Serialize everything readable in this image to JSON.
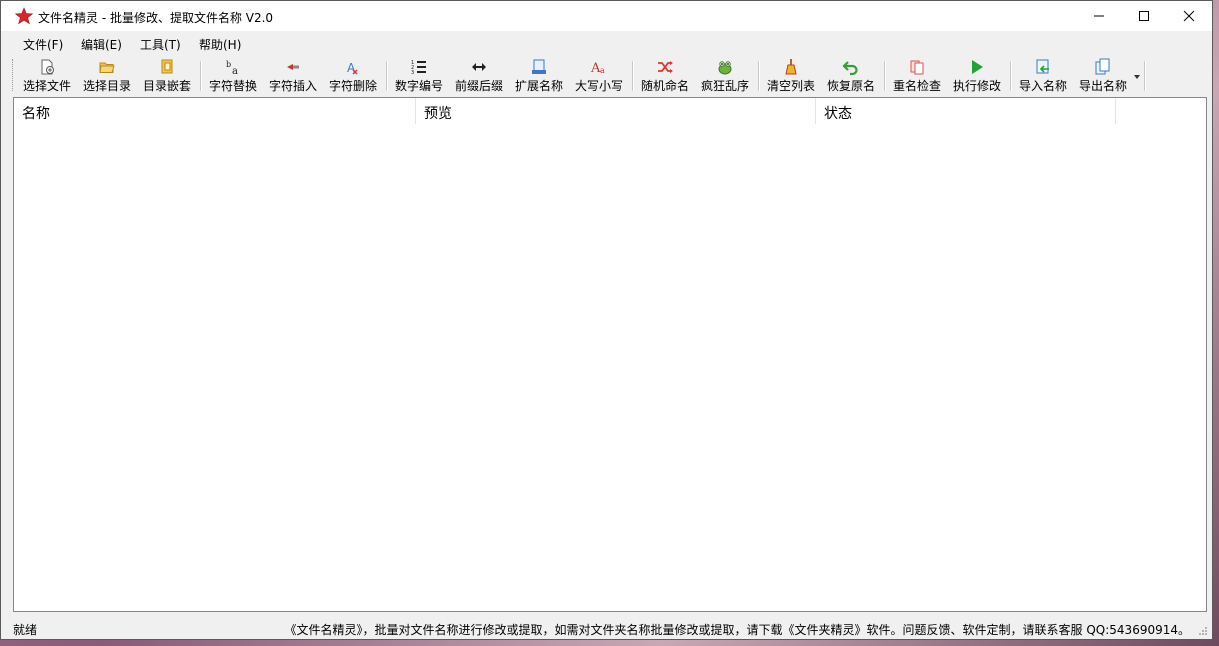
{
  "window": {
    "title": "文件名精灵 - 批量修改、提取文件名称  V2.0",
    "controls": [
      "minimize",
      "maximize",
      "close"
    ]
  },
  "menu": [
    {
      "label": "文件(F)"
    },
    {
      "label": "编辑(E)"
    },
    {
      "label": "工具(T)"
    },
    {
      "label": "帮助(H)"
    }
  ],
  "toolbar": {
    "items": [
      {
        "label": "选择文件",
        "icon": "add-file-icon"
      },
      {
        "label": "选择目录",
        "icon": "open-folder-icon"
      },
      {
        "label": "目录嵌套",
        "icon": "nested-folder-icon"
      },
      {
        "label": "字符替换",
        "icon": "replace-icon"
      },
      {
        "label": "字符插入",
        "icon": "insert-icon"
      },
      {
        "label": "字符删除",
        "icon": "delete-char-icon"
      },
      {
        "label": "数字编号",
        "icon": "numbered-list-icon"
      },
      {
        "label": "前缀后缀",
        "icon": "left-right-arrow-icon"
      },
      {
        "label": "扩展名称",
        "icon": "extension-icon"
      },
      {
        "label": "大写小写",
        "icon": "case-icon"
      },
      {
        "label": "随机命名",
        "icon": "shuffle-icon"
      },
      {
        "label": "疯狂乱序",
        "icon": "frog-icon"
      },
      {
        "label": "清空列表",
        "icon": "broom-icon"
      },
      {
        "label": "恢复原名",
        "icon": "undo-icon"
      },
      {
        "label": "重名检查",
        "icon": "duplicate-check-icon"
      },
      {
        "label": "执行修改",
        "icon": "play-icon"
      },
      {
        "label": "导入名称",
        "icon": "import-icon"
      },
      {
        "label": "导出名称",
        "icon": "export-icon"
      }
    ]
  },
  "table": {
    "columns": [
      {
        "label": "名称"
      },
      {
        "label": "预览"
      },
      {
        "label": "状态"
      },
      {
        "label": ""
      }
    ],
    "rows": []
  },
  "status": {
    "left": "就绪",
    "right": "《文件名精灵》，批量对文件名称进行修改或提取，如需对文件夹名称批量修改或提取，请下载《文件夹精灵》软件。问题反馈、软件定制，请联系客服 QQ:543690914。"
  },
  "colors": {
    "accent_red": "#d7262d",
    "play_green": "#21a335",
    "undo_green": "#3d9b35",
    "shuffle_red": "#e0352b",
    "icon_blue": "#3b78c9"
  }
}
